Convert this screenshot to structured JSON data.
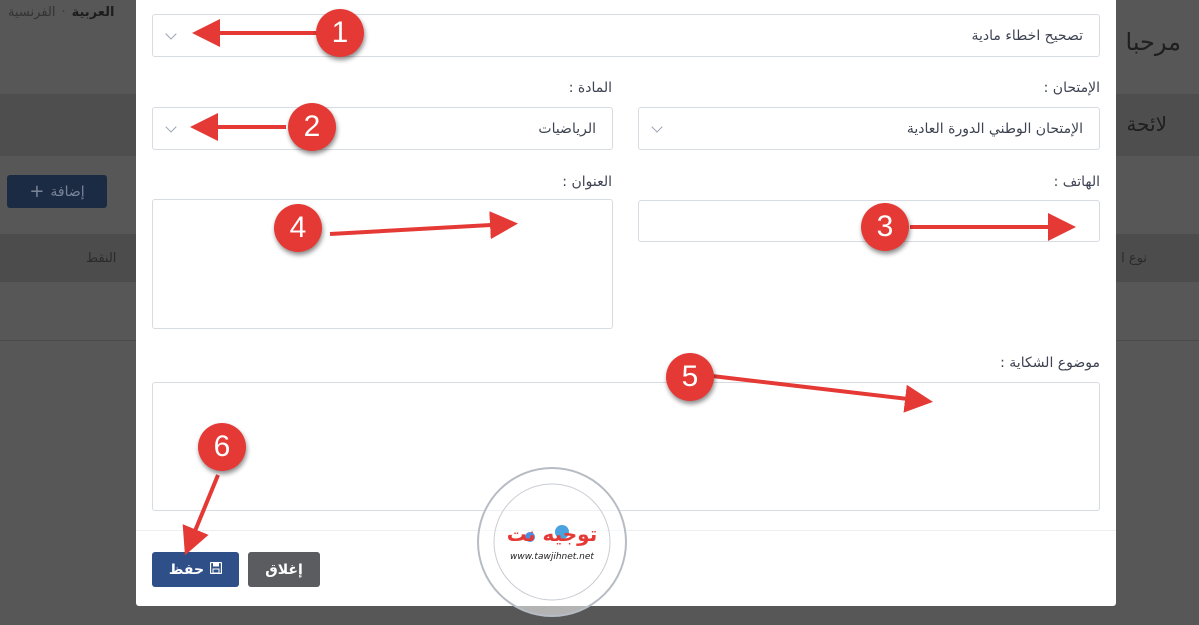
{
  "background": {
    "lang_active": "العربية",
    "lang_other": "الفرنسية",
    "welcome": "مرحبا ب",
    "list_title": "لائحة",
    "add_button": "إضافة",
    "col_points": "النقط",
    "col_type": "نوع ا"
  },
  "modal": {
    "category_select": {
      "value": "تصحيح اخطاء مادية"
    },
    "exam": {
      "label": "الإمتحان :",
      "value": "الإمتحان الوطني الدورة العادية"
    },
    "subject": {
      "label": "المادة :",
      "value": "الرياضيات"
    },
    "phone": {
      "label": "الهاتف :",
      "value": ""
    },
    "address": {
      "label": "العنوان :",
      "value": ""
    },
    "complaint": {
      "label": "موضوع الشكاية :",
      "value": ""
    },
    "save_button": "حفظ",
    "close_button": "إغلاق"
  },
  "watermark": {
    "arabic": "توجيه نت",
    "url": "www.tawjihnet.net"
  },
  "annotations": {
    "badges": [
      "1",
      "2",
      "3",
      "4",
      "5",
      "6"
    ],
    "color": "#e53935"
  }
}
